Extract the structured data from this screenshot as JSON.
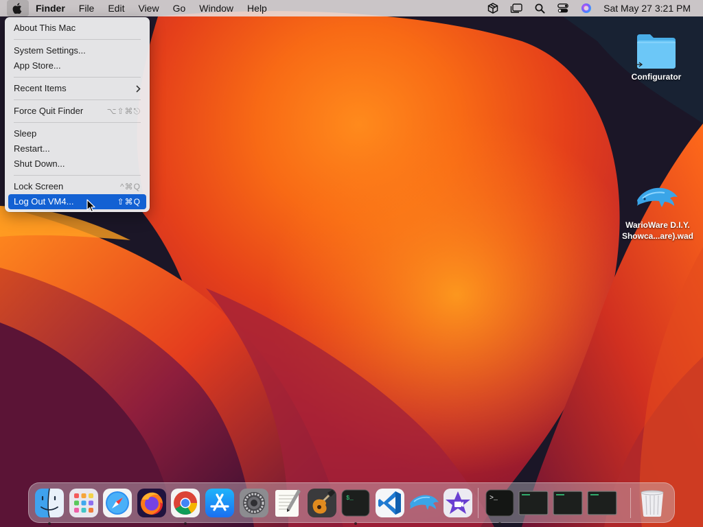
{
  "menubar": {
    "apple_icon": "apple-logo-icon",
    "app_name": "Finder",
    "menus": [
      "File",
      "Edit",
      "View",
      "Go",
      "Window",
      "Help"
    ],
    "status_icons": [
      "box-icon",
      "stage-manager-icon",
      "spotlight-search-icon",
      "control-center-icon",
      "siri-icon"
    ],
    "clock": "Sat May 27  3:21 PM"
  },
  "apple_menu": {
    "about": "About This Mac",
    "system_settings": "System Settings...",
    "app_store": "App Store...",
    "recent_items": "Recent Items",
    "force_quit": "Force Quit Finder",
    "force_quit_shortcut": "⌥⇧⌘⎋",
    "sleep": "Sleep",
    "restart": "Restart...",
    "shut_down": "Shut Down...",
    "lock_screen": "Lock Screen",
    "lock_screen_shortcut": "^⌘Q",
    "log_out": "Log Out VM4...",
    "log_out_shortcut": "⇧⌘Q"
  },
  "desktop": {
    "items": [
      {
        "label": "Configurator",
        "icon": "folder-alias-icon"
      },
      {
        "label_line1": "WarioWare D.I.Y.",
        "label_line2": "Showca...are).wad",
        "icon": "dolphin-icon"
      }
    ]
  },
  "dock": {
    "apps": [
      "Finder",
      "Launchpad",
      "Safari",
      "Firefox",
      "Google Chrome",
      "App Store",
      "System Settings",
      "TextEdit",
      "GarageBand",
      "Terminal",
      "Visual Studio Code",
      "Dolphin",
      "iMovie"
    ],
    "running": [
      "Terminal",
      "Terminal",
      "Terminal",
      "Terminal"
    ],
    "trash": "Trash",
    "running_indicators": [
      "Finder",
      "Google Chrome",
      "Terminal",
      "Terminal"
    ]
  },
  "colors": {
    "selection": "#1361d3",
    "folder": "#5cc0f5",
    "wallpaper_orange": "#f7641c"
  }
}
